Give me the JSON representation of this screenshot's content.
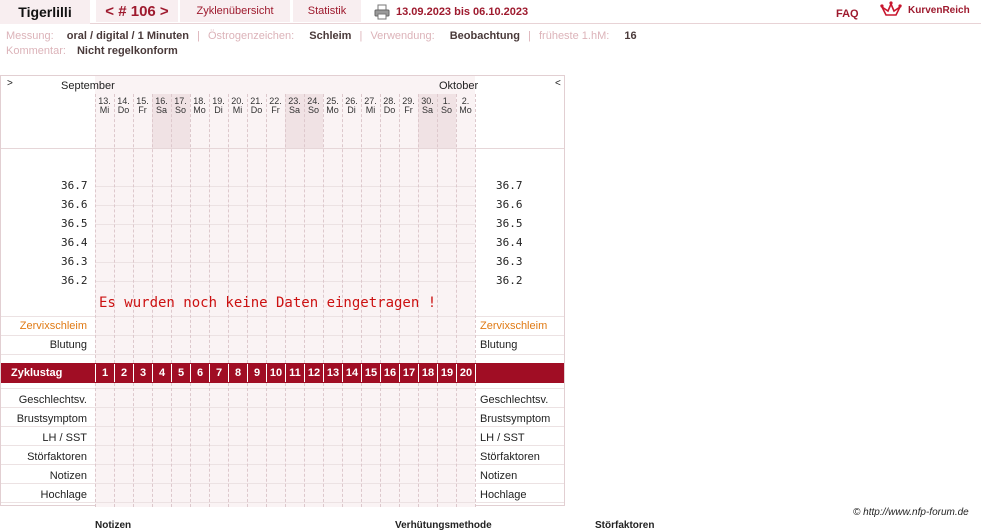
{
  "header": {
    "brand": "Tigerlilli",
    "cycle": "< # 106 >",
    "overview": "Zyklenübersicht",
    "stats": "Statistik",
    "daterange": "13.09.2023 bis 06.10.2023",
    "faq": "FAQ",
    "logo": "KurvenReich"
  },
  "info": {
    "messung_label": "Messung:",
    "messung_value": "oral / digital / 1 Minuten",
    "oestrogen_label": "Östrogenzeichen:",
    "oestrogen_value": "Schleim",
    "verwendung_label": "Verwendung:",
    "verwendung_value": "Beobachtung",
    "hm_label": "früheste 1.hM:",
    "hm_value": "16",
    "kommentar_label": "Kommentar:",
    "kommentar_value": "Nicht regelkonform"
  },
  "chart": {
    "nav_prev": ">",
    "nav_next": "<",
    "month_left": "September",
    "month_right": "Oktober",
    "days": [
      {
        "d": "13.",
        "w": "Mi",
        "we": false
      },
      {
        "d": "14.",
        "w": "Do",
        "we": false
      },
      {
        "d": "15.",
        "w": "Fr",
        "we": false
      },
      {
        "d": "16.",
        "w": "Sa",
        "we": true
      },
      {
        "d": "17.",
        "w": "So",
        "we": true
      },
      {
        "d": "18.",
        "w": "Mo",
        "we": false
      },
      {
        "d": "19.",
        "w": "Di",
        "we": false
      },
      {
        "d": "20.",
        "w": "Mi",
        "we": false
      },
      {
        "d": "21.",
        "w": "Do",
        "we": false
      },
      {
        "d": "22.",
        "w": "Fr",
        "we": false
      },
      {
        "d": "23.",
        "w": "Sa",
        "we": true
      },
      {
        "d": "24.",
        "w": "So",
        "we": true
      },
      {
        "d": "25.",
        "w": "Mo",
        "we": false
      },
      {
        "d": "26.",
        "w": "Di",
        "we": false
      },
      {
        "d": "27.",
        "w": "Mi",
        "we": false
      },
      {
        "d": "28.",
        "w": "Do",
        "we": false
      },
      {
        "d": "29.",
        "w": "Fr",
        "we": false
      },
      {
        "d": "30.",
        "w": "Sa",
        "we": true
      },
      {
        "d": "1.",
        "w": "So",
        "we": true
      },
      {
        "d": "2.",
        "w": "Mo",
        "we": false
      }
    ],
    "temps": [
      "36.7",
      "36.6",
      "36.5",
      "36.4",
      "36.3",
      "36.2"
    ],
    "no_data": "Es wurden noch keine Daten eingetragen !",
    "zervix": "Zervixschleim",
    "blutung": "Blutung",
    "zyklustag": "Zyklustag",
    "cycle_days": [
      "1",
      "2",
      "3",
      "4",
      "5",
      "6",
      "7",
      "8",
      "9",
      "10",
      "11",
      "12",
      "13",
      "14",
      "15",
      "16",
      "17",
      "18",
      "19",
      "20"
    ],
    "bottom_rows": [
      "Geschlechtsv.",
      "Brustsymptom",
      "LH / SST",
      "Störfaktoren",
      "Notizen",
      "Hochlage"
    ]
  },
  "footer": {
    "copyright": "© http://www.nfp-forum.de",
    "col1": "Notizen",
    "col2": "Verhütungsmethode",
    "col3": "Störfaktoren"
  },
  "colors": {
    "accent": "#a00d24",
    "tab_bg": "#f8eef0",
    "orange": "#e07a14",
    "nodata": "#cc1111"
  }
}
